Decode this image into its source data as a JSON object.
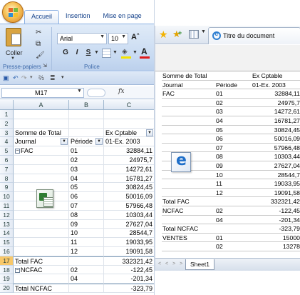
{
  "excel": {
    "ribbon": {
      "tabs": [
        "Accueil",
        "Insertion",
        "Mise en page"
      ],
      "clipboard": {
        "paste_label": "Coller",
        "group_label": "Presse-papiers"
      },
      "font": {
        "font_name": "Arial",
        "font_size": "10",
        "grow_label": "A",
        "group_label": "Police"
      },
      "format_buttons": [
        "G",
        "I",
        "S"
      ]
    },
    "formula_bar": {
      "name_box": "M17",
      "fx_label": "fx"
    },
    "columns": [
      "A",
      "B",
      "C"
    ],
    "rows": [
      {
        "num": "1",
        "a": "",
        "b": "",
        "c": ""
      },
      {
        "num": "2",
        "a": "",
        "b": "",
        "c": ""
      },
      {
        "num": "3",
        "a": "Somme de Total",
        "b": "",
        "c": "Ex Cptable"
      },
      {
        "num": "4",
        "a": "Journal",
        "b": "Période",
        "c": "01-Ex. 2003"
      },
      {
        "num": "5",
        "a": "FAC",
        "b": "01",
        "c": "32884,11"
      },
      {
        "num": "6",
        "a": "",
        "b": "02",
        "c": "24975,7"
      },
      {
        "num": "7",
        "a": "",
        "b": "03",
        "c": "14272,61"
      },
      {
        "num": "8",
        "a": "",
        "b": "04",
        "c": "16781,27"
      },
      {
        "num": "9",
        "a": "",
        "b": "05",
        "c": "30824,45"
      },
      {
        "num": "10",
        "a": "",
        "b": "06",
        "c": "50016,09"
      },
      {
        "num": "11",
        "a": "",
        "b": "07",
        "c": "57966,48"
      },
      {
        "num": "12",
        "a": "",
        "b": "08",
        "c": "10303,44"
      },
      {
        "num": "13",
        "a": "",
        "b": "09",
        "c": "27627,04"
      },
      {
        "num": "14",
        "a": "",
        "b": "10",
        "c": "28544,7"
      },
      {
        "num": "15",
        "a": "",
        "b": "11",
        "c": "19033,95"
      },
      {
        "num": "16",
        "a": "",
        "b": "12",
        "c": "19091,58"
      },
      {
        "num": "17",
        "a": "Total FAC",
        "b": "",
        "c": "332321,42"
      },
      {
        "num": "18",
        "a": "NCFAC",
        "b": "02",
        "c": "-122,45"
      },
      {
        "num": "19",
        "a": "",
        "b": "04",
        "c": "-201,34"
      },
      {
        "num": "20",
        "a": "Total NCFAC",
        "b": "",
        "c": "-323,79"
      }
    ]
  },
  "ie": {
    "tab_title": "Titre du document",
    "sheet_tab": "Sheet1",
    "nav_arrows": "< < > >",
    "pivot": [
      {
        "a": "Somme de Total",
        "b": "",
        "c": "Ex Cptable"
      },
      {
        "a": "Journal",
        "b": "Période",
        "c": "01-Ex. 2003"
      },
      {
        "a": "FAC",
        "b": "01",
        "c": "32884,11"
      },
      {
        "a": "",
        "b": "02",
        "c": "24975,7"
      },
      {
        "a": "",
        "b": "03",
        "c": "14272,61"
      },
      {
        "a": "",
        "b": "04",
        "c": "16781,27"
      },
      {
        "a": "",
        "b": "05",
        "c": "30824,45"
      },
      {
        "a": "",
        "b": "06",
        "c": "50016,09"
      },
      {
        "a": "",
        "b": "07",
        "c": "57966,48"
      },
      {
        "a": "",
        "b": "08",
        "c": "10303,44"
      },
      {
        "a": "",
        "b": "09",
        "c": "27627,04"
      },
      {
        "a": "",
        "b": "10",
        "c": "28544,7"
      },
      {
        "a": "",
        "b": "11",
        "c": "19033,95"
      },
      {
        "a": "",
        "b": "12",
        "c": "19091,58"
      },
      {
        "a": "Total FAC",
        "b": "",
        "c": "332321,42"
      },
      {
        "a": "NCFAC",
        "b": "02",
        "c": "-122,45"
      },
      {
        "a": "",
        "b": "04",
        "c": "-201,34"
      },
      {
        "a": "Total NCFAC",
        "b": "",
        "c": "-323,79"
      },
      {
        "a": "VENTES",
        "b": "01",
        "c": "15000"
      },
      {
        "a": "",
        "b": "02",
        "c": "13278"
      }
    ]
  },
  "colors": {
    "office_orange": "#f6c35a",
    "ribbon_blue": "#c6d9f1",
    "header_blue": "#dde6f2",
    "selected_row": "#f8c86a",
    "ie_blue": "#1f6fc9"
  }
}
